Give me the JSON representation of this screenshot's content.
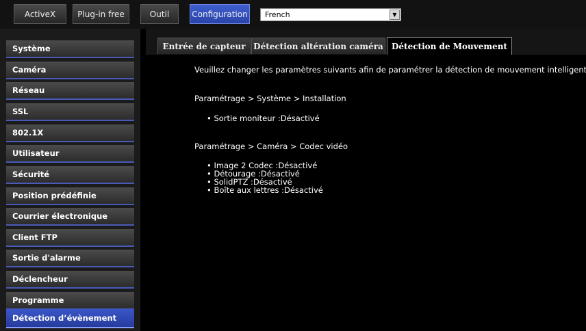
{
  "topnav": {
    "activex": "ActiveX",
    "pluginfree": "Plug-in free",
    "outil": "Outil",
    "configuration": "Configuration",
    "language": "French"
  },
  "sidebar": {
    "items": [
      "Système",
      "Caméra",
      "Réseau",
      "SSL",
      "802.1X",
      "Utilisateur",
      "Sécurité",
      "Position prédéfinie",
      "Courrier électronique",
      "Client FTP",
      "Sortie d'alarme",
      "Déclencheur",
      "Programme",
      "Détection d’évènement"
    ],
    "active_index": 13
  },
  "tabs": [
    "Entrée de capteur",
    "Détection altération caméra",
    "Détection de Mouvement"
  ],
  "content": {
    "intro": "Veuillez changer les paramètres suivants afin de paramétrer la détection de mouvement intelligente.",
    "section1": {
      "path": "Paramétrage > Système > Installation",
      "items": [
        "Sortie moniteur :Désactivé"
      ]
    },
    "section2": {
      "path": "Paramétrage > Caméra > Codec vidéo",
      "items": [
        "Image 2 Codec :Désactivé",
        "Détourage :Désactivé",
        "SolidPTZ :Désactivé",
        "Boîte aux lettres :Désactivé"
      ]
    }
  },
  "colors": {
    "accent": "#2f4cc0",
    "background": "#000000",
    "sidebar_underline": "#4a5ab8"
  }
}
